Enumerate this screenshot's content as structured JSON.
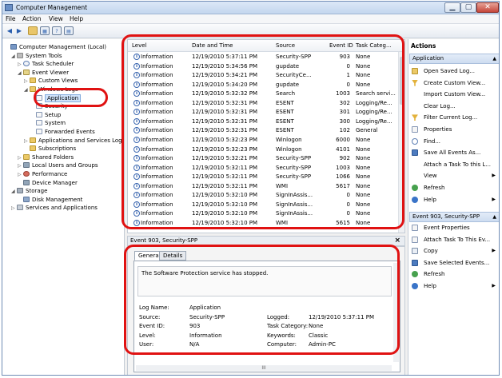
{
  "window": {
    "title": "Computer Management"
  },
  "menu": [
    "File",
    "Action",
    "View",
    "Help"
  ],
  "tree": [
    {
      "label": "Computer Management (Local)",
      "indent": 0,
      "icon": "computer-icon",
      "expander": "",
      "cls": "ico-comp"
    },
    {
      "label": "System Tools",
      "indent": 1,
      "icon": "tools-icon",
      "expander": "◢",
      "cls": "ico-tool"
    },
    {
      "label": "Task Scheduler",
      "indent": 2,
      "icon": "clock-icon",
      "expander": "▷",
      "cls": "ico-clock"
    },
    {
      "label": "Event Viewer",
      "indent": 2,
      "icon": "event-viewer-icon",
      "expander": "◢",
      "cls": "ico-ev"
    },
    {
      "label": "Custom Views",
      "indent": 3,
      "icon": "folder-icon",
      "expander": "▷",
      "cls": "ico-folder"
    },
    {
      "label": "Windows Logs",
      "indent": 3,
      "icon": "folder-icon",
      "expander": "◢",
      "cls": "ico-folder"
    },
    {
      "label": "Application",
      "indent": 4,
      "icon": "log-icon",
      "expander": "",
      "cls": "ico-log",
      "selected": true
    },
    {
      "label": "Security",
      "indent": 4,
      "icon": "log-icon",
      "expander": "",
      "cls": "ico-log"
    },
    {
      "label": "Setup",
      "indent": 4,
      "icon": "log-icon",
      "expander": "",
      "cls": "ico-log"
    },
    {
      "label": "System",
      "indent": 4,
      "icon": "log-icon",
      "expander": "",
      "cls": "ico-log"
    },
    {
      "label": "Forwarded Events",
      "indent": 4,
      "icon": "log-icon",
      "expander": "",
      "cls": "ico-log"
    },
    {
      "label": "Applications and Services Log",
      "indent": 3,
      "icon": "folder-icon",
      "expander": "▷",
      "cls": "ico-folder"
    },
    {
      "label": "Subscriptions",
      "indent": 3,
      "icon": "folder-icon",
      "expander": "",
      "cls": "ico-folder"
    },
    {
      "label": "Shared Folders",
      "indent": 2,
      "icon": "shared-folder-icon",
      "expander": "▷",
      "cls": "ico-folder"
    },
    {
      "label": "Local Users and Groups",
      "indent": 2,
      "icon": "users-icon",
      "expander": "▷",
      "cls": "ico-dev"
    },
    {
      "label": "Performance",
      "indent": 2,
      "icon": "performance-icon",
      "expander": "▷",
      "cls": "ico-perf"
    },
    {
      "label": "Device Manager",
      "indent": 2,
      "icon": "device-manager-icon",
      "expander": "",
      "cls": "ico-dev"
    },
    {
      "label": "Storage",
      "indent": 1,
      "icon": "storage-icon",
      "expander": "◢",
      "cls": "ico-store"
    },
    {
      "label": "Disk Management",
      "indent": 2,
      "icon": "disk-icon",
      "expander": "",
      "cls": "ico-disk"
    },
    {
      "label": "Services and Applications",
      "indent": 1,
      "icon": "services-icon",
      "expander": "▷",
      "cls": "ico-svc"
    }
  ],
  "list": {
    "columns": [
      "Level",
      "Date and Time",
      "Source",
      "Event ID",
      "Task Categ..."
    ],
    "rows": [
      [
        "Information",
        "12/19/2010 5:37:11 PM",
        "Security-SPP",
        "903",
        "None"
      ],
      [
        "Information",
        "12/19/2010 5:34:56 PM",
        "gupdate",
        "0",
        "None"
      ],
      [
        "Information",
        "12/19/2010 5:34:21 PM",
        "SecurityCe...",
        "1",
        "None"
      ],
      [
        "Information",
        "12/19/2010 5:34:20 PM",
        "gupdate",
        "0",
        "None"
      ],
      [
        "Information",
        "12/19/2010 5:32:32 PM",
        "Search",
        "1003",
        "Search servi..."
      ],
      [
        "Information",
        "12/19/2010 5:32:31 PM",
        "ESENT",
        "302",
        "Logging/Re..."
      ],
      [
        "Information",
        "12/19/2010 5:32:31 PM",
        "ESENT",
        "301",
        "Logging/Re..."
      ],
      [
        "Information",
        "12/19/2010 5:32:31 PM",
        "ESENT",
        "300",
        "Logging/Re..."
      ],
      [
        "Information",
        "12/19/2010 5:32:31 PM",
        "ESENT",
        "102",
        "General"
      ],
      [
        "Information",
        "12/19/2010 5:32:23 PM",
        "Winlogon",
        "6000",
        "None"
      ],
      [
        "Information",
        "12/19/2010 5:32:23 PM",
        "Winlogon",
        "4101",
        "None"
      ],
      [
        "Information",
        "12/19/2010 5:32:21 PM",
        "Security-SPP",
        "902",
        "None"
      ],
      [
        "Information",
        "12/19/2010 5:32:11 PM",
        "Security-SPP",
        "1003",
        "None"
      ],
      [
        "Information",
        "12/19/2010 5:32:11 PM",
        "Security-SPP",
        "1066",
        "None"
      ],
      [
        "Information",
        "12/19/2010 5:32:11 PM",
        "WMI",
        "5617",
        "None"
      ],
      [
        "Information",
        "12/19/2010 5:32:10 PM",
        "SignInAssis...",
        "0",
        "None"
      ],
      [
        "Information",
        "12/19/2010 5:32:10 PM",
        "SignInAssis...",
        "0",
        "None"
      ],
      [
        "Information",
        "12/19/2010 5:32:10 PM",
        "SignInAssis...",
        "0",
        "None"
      ],
      [
        "Information",
        "12/19/2010 5:32:10 PM",
        "WMI",
        "5615",
        "None"
      ]
    ]
  },
  "detail": {
    "title": "Event 903, Security-SPP",
    "close": "×",
    "tabs": [
      "General",
      "Details"
    ],
    "message": "The Software Protection service has stopped.",
    "fields_left": [
      {
        "k": "Log Name:",
        "v": "Application"
      },
      {
        "k": "Source:",
        "v": "Security-SPP"
      },
      {
        "k": "Event ID:",
        "v": "903"
      },
      {
        "k": "Level:",
        "v": "Information"
      },
      {
        "k": "User:",
        "v": "N/A"
      }
    ],
    "fields_right": [
      {
        "k": "Logged:",
        "v": "12/19/2010 5:37:11 PM"
      },
      {
        "k": "Task Category:",
        "v": "None"
      },
      {
        "k": "Keywords:",
        "v": "Classic"
      },
      {
        "k": "Computer:",
        "v": "Admin-PC"
      }
    ],
    "hscroll_grip": "III"
  },
  "actions": {
    "title": "Actions",
    "section1": "Application",
    "items1": [
      {
        "label": "Open Saved Log...",
        "icon": "open-folder-icon",
        "cls": "ai-open"
      },
      {
        "label": "Create Custom View...",
        "icon": "filter-icon",
        "cls": "ai-filter"
      },
      {
        "label": "Import Custom View...",
        "icon": "",
        "cls": "ai-none"
      },
      {
        "label": "Clear Log...",
        "icon": "",
        "cls": "ai-none"
      },
      {
        "label": "Filter Current Log...",
        "icon": "filter-icon",
        "cls": "ai-filter"
      },
      {
        "label": "Properties",
        "icon": "properties-icon",
        "cls": "ai-doc"
      },
      {
        "label": "Find...",
        "icon": "find-icon",
        "cls": "ai-find"
      },
      {
        "label": "Save All Events As...",
        "icon": "save-icon",
        "cls": "ai-save"
      },
      {
        "label": "Attach a Task To this L...",
        "icon": "",
        "cls": "ai-none"
      },
      {
        "label": "View",
        "icon": "",
        "cls": "ai-none",
        "submenu": "▶"
      },
      {
        "label": "Refresh",
        "icon": "refresh-icon",
        "cls": "ai-refresh"
      },
      {
        "label": "Help",
        "icon": "help-icon",
        "cls": "ai-help",
        "submenu": "▶"
      }
    ],
    "section2": "Event 903, Security-SPP",
    "items2": [
      {
        "label": "Event Properties",
        "icon": "event-properties-icon",
        "cls": "ai-doc"
      },
      {
        "label": "Attach Task To This Ev...",
        "icon": "attach-task-icon",
        "cls": "ai-doc"
      },
      {
        "label": "Copy",
        "icon": "copy-icon",
        "cls": "ai-copy",
        "submenu": "▶"
      },
      {
        "label": "Save Selected Events...",
        "icon": "save-icon",
        "cls": "ai-save"
      },
      {
        "label": "Refresh",
        "icon": "refresh-icon",
        "cls": "ai-refresh"
      },
      {
        "label": "Help",
        "icon": "help-icon",
        "cls": "ai-help",
        "submenu": "▶"
      }
    ]
  }
}
